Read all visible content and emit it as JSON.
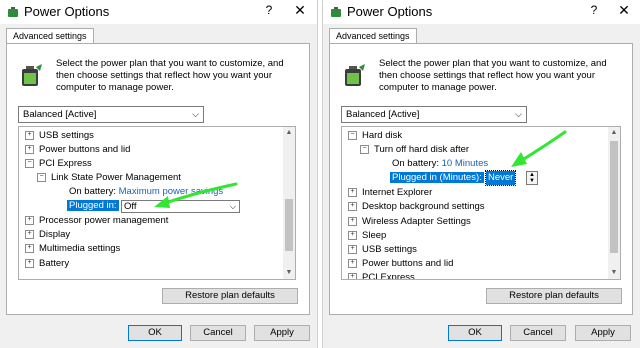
{
  "left": {
    "window": {
      "title": "Power Options",
      "help": "?",
      "close": "✕"
    },
    "tab": "Advanced settings",
    "description": "Select the power plan that you want to customize, and then choose settings that reflect how you want your computer to manage power.",
    "plan": "Balanced [Active]",
    "tree": {
      "usb": "USB settings",
      "power_buttons": "Power buttons and lid",
      "pci": "PCI Express",
      "link_state": "Link State Power Management",
      "on_battery_label": "On battery:",
      "on_battery_value": "Maximum power savings",
      "plugged_label": "Plugged in:",
      "plugged_value": "Off",
      "processor": "Processor power management",
      "display": "Display",
      "multimedia": "Multimedia settings",
      "battery": "Battery"
    },
    "restore": "Restore plan defaults",
    "ok": "OK",
    "cancel": "Cancel",
    "apply": "Apply"
  },
  "right": {
    "window": {
      "title": "Power Options",
      "help": "?",
      "close": "✕"
    },
    "tab": "Advanced settings",
    "description": "Select the power plan that you want to customize, and then choose settings that reflect how you want your computer to manage power.",
    "plan": "Balanced [Active]",
    "tree": {
      "hard_disk": "Hard disk",
      "turn_off": "Turn off hard disk after",
      "on_battery_label": "On battery:",
      "on_battery_value": "10 Minutes",
      "plugged_label": "Plugged in (Minutes):",
      "plugged_value": "Never",
      "ie": "Internet Explorer",
      "desktop_bg": "Desktop background settings",
      "wireless": "Wireless Adapter Settings",
      "sleep": "Sleep",
      "usb": "USB settings",
      "power_buttons": "Power buttons and lid",
      "pci": "PCI Express"
    },
    "restore": "Restore plan defaults",
    "ok": "OK",
    "cancel": "Cancel",
    "apply": "Apply"
  },
  "colors": {
    "link": "#1b61b5",
    "selection": "#0078d7",
    "annotation_arrow": "#33e633"
  }
}
